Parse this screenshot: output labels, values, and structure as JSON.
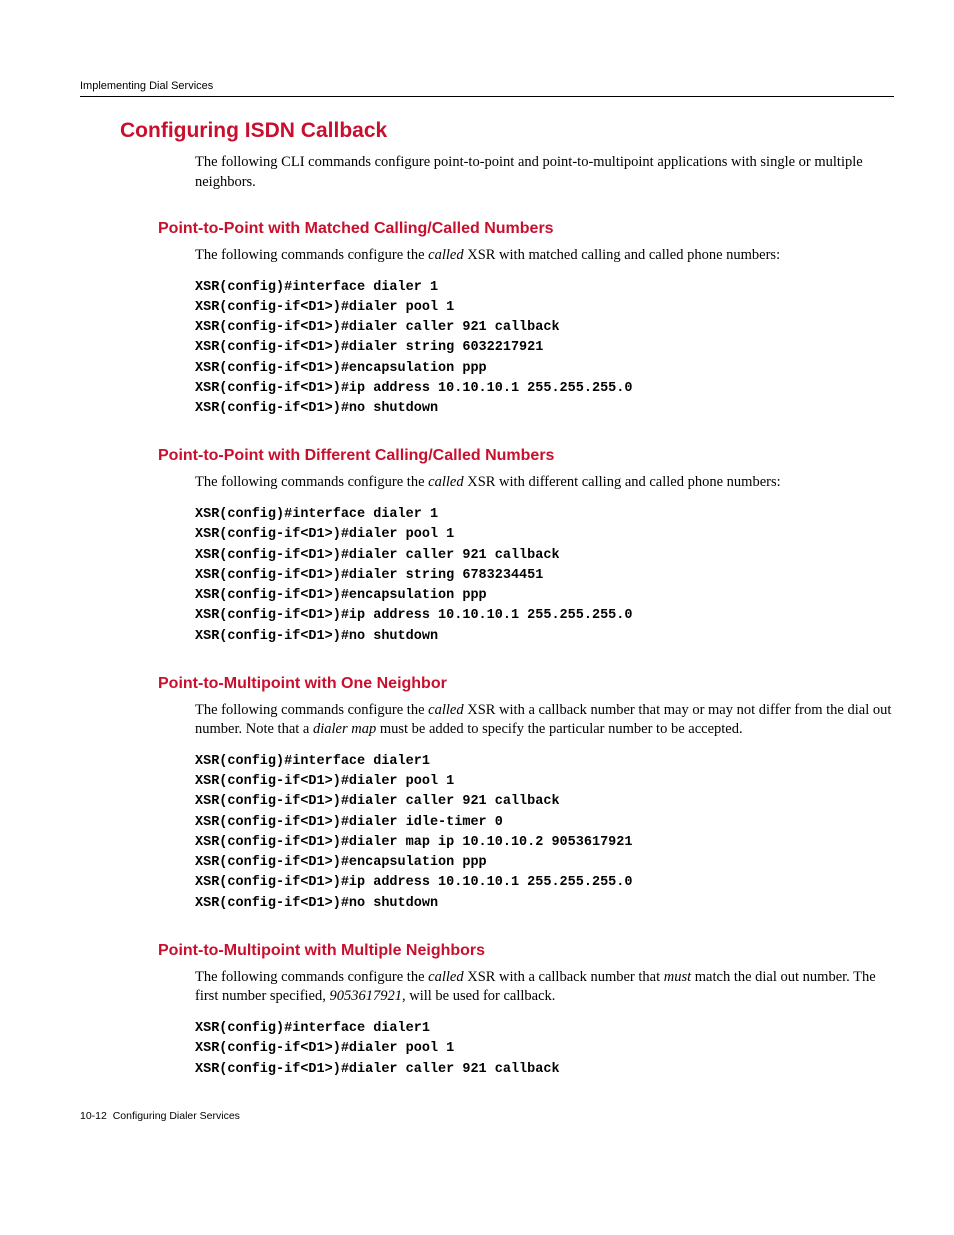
{
  "runningHead": "Implementing Dial Services",
  "h1": "Configuring ISDN Callback",
  "intro": "The following CLI commands configure point-to-point and point-to-multipoint applications with single or multiple neighbors.",
  "sec1": {
    "title": "Point-to-Point with Matched Calling/Called Numbers",
    "p_before": "The following commands configure the ",
    "p_em": "called",
    "p_after": " XSR with matched calling and called phone numbers:",
    "code": "XSR(config)#interface dialer 1\nXSR(config-if<D1>)#dialer pool 1\nXSR(config-if<D1>)#dialer caller 921 callback\nXSR(config-if<D1>)#dialer string 6032217921\nXSR(config-if<D1>)#encapsulation ppp\nXSR(config-if<D1>)#ip address 10.10.10.1 255.255.255.0\nXSR(config-if<D1>)#no shutdown"
  },
  "sec2": {
    "title": "Point-to-Point with Different Calling/Called Numbers",
    "p_before": "The following commands configure the ",
    "p_em": "called",
    "p_after": " XSR with different calling and called phone numbers:",
    "code": "XSR(config)#interface dialer 1\nXSR(config-if<D1>)#dialer pool 1\nXSR(config-if<D1>)#dialer caller 921 callback\nXSR(config-if<D1>)#dialer string 6783234451\nXSR(config-if<D1>)#encapsulation ppp\nXSR(config-if<D1>)#ip address 10.10.10.1 255.255.255.0\nXSR(config-if<D1>)#no shutdown"
  },
  "sec3": {
    "title": "Point-to-Multipoint with One Neighbor",
    "p_before": "The following commands configure the ",
    "p_em1": "called",
    "p_mid": " XSR with a callback number that may or may not differ from the dial out number. Note that a ",
    "p_em2": "dialer map",
    "p_after": " must be added to specify the particular number to be accepted.",
    "code": "XSR(config)#interface dialer1\nXSR(config-if<D1>)#dialer pool 1\nXSR(config-if<D1>)#dialer caller 921 callback\nXSR(config-if<D1>)#dialer idle-timer 0\nXSR(config-if<D1>)#dialer map ip 10.10.10.2 9053617921\nXSR(config-if<D1>)#encapsulation ppp\nXSR(config-if<D1>)#ip address 10.10.10.1 255.255.255.0\nXSR(config-if<D1>)#no shutdown"
  },
  "sec4": {
    "title": "Point-to-Multipoint with Multiple Neighbors",
    "p_before": "The following commands configure the ",
    "p_em1": "called",
    "p_mid1": " XSR with a callback number that ",
    "p_em2": "must",
    "p_mid2": " match the dial out number. The first number specified, ",
    "p_em3": "9053617921",
    "p_after": ", will be used for callback.",
    "code": "XSR(config)#interface dialer1\nXSR(config-if<D1>)#dialer pool 1\nXSR(config-if<D1>)#dialer caller 921 callback"
  },
  "footerPage": "10-12",
  "footerTitle": "Configuring Dialer Services"
}
